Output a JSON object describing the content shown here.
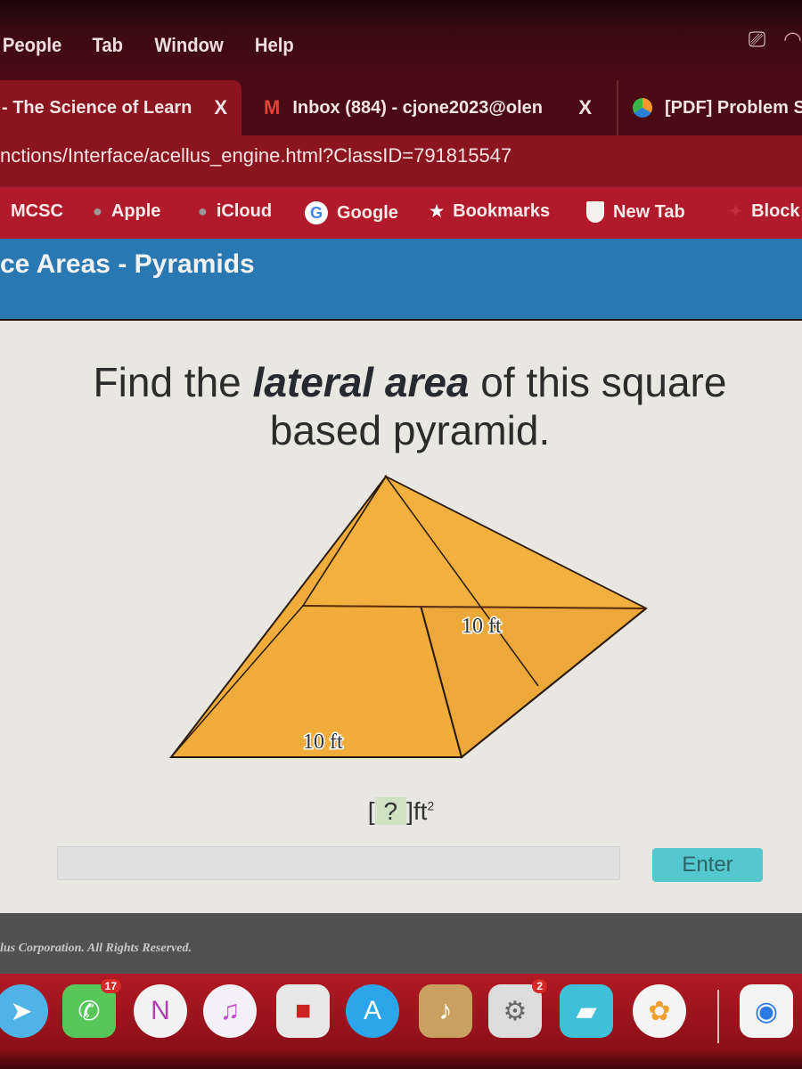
{
  "menubar": {
    "items": [
      "People",
      "Tab",
      "Window",
      "Help"
    ],
    "status_icons": [
      "airplay-icon",
      "wifi-icon"
    ]
  },
  "tabs": [
    {
      "title": "- The Science of Learn",
      "icon": "acellus-icon",
      "active": true,
      "close": "X"
    },
    {
      "title": "Inbox (884) - cjone2023@olen",
      "icon": "gmail-icon",
      "active": false,
      "close": "X"
    },
    {
      "title": "[PDF] Problem S",
      "icon": "pdf-icon",
      "active": false
    }
  ],
  "urlbar": {
    "url": "nctions/Interface/acellus_engine.html?ClassID=791815547"
  },
  "bookmarks": [
    {
      "label": "MCSC",
      "icon": ""
    },
    {
      "label": "Apple",
      "icon": "apple-icon"
    },
    {
      "label": "iCloud",
      "icon": "apple-icon"
    },
    {
      "label": "Google",
      "icon": "google-icon"
    },
    {
      "label": "Bookmarks",
      "icon": "star-icon"
    },
    {
      "label": "New Tab",
      "icon": "shield-icon"
    },
    {
      "label": "Block",
      "icon": "block-icon"
    }
  ],
  "banner": {
    "title": "ce Areas - Pyramids"
  },
  "question": {
    "prefix": "Find the ",
    "emphasis": "lateral area",
    "suffix": " of this square based pyramid."
  },
  "figure": {
    "shape": "square based pyramid",
    "fill_color": "#f0ad3c",
    "labels": {
      "base_edge": "10 ft",
      "slant_height": "10 ft"
    }
  },
  "answer": {
    "open": "[",
    "placeholder": "?",
    "close": "]",
    "unit": "ft",
    "exponent": "2",
    "input_value": "",
    "enter_label": "Enter"
  },
  "footer": {
    "copyright": "lus Corporation.  All Rights Reserved."
  },
  "dock": {
    "apps": [
      {
        "name": "safari",
        "badge": ""
      },
      {
        "name": "facetime-messages",
        "badge": "17"
      },
      {
        "name": "news",
        "badge": ""
      },
      {
        "name": "itunes",
        "badge": ""
      },
      {
        "name": "roblox",
        "badge": ""
      },
      {
        "name": "app-store",
        "badge": ""
      },
      {
        "name": "garageband",
        "badge": ""
      },
      {
        "name": "system-preferences",
        "badge": "2"
      },
      {
        "name": "roblox-studio",
        "badge": ""
      },
      {
        "name": "photos",
        "badge": ""
      },
      {
        "name": "chrome",
        "badge": ""
      }
    ]
  },
  "colors": {
    "banner_blue": "#2a78b2",
    "bookmark_red": "#b11a2a",
    "enter_teal": "#54c7cf",
    "pyramid_orange": "#f0ad3c"
  }
}
